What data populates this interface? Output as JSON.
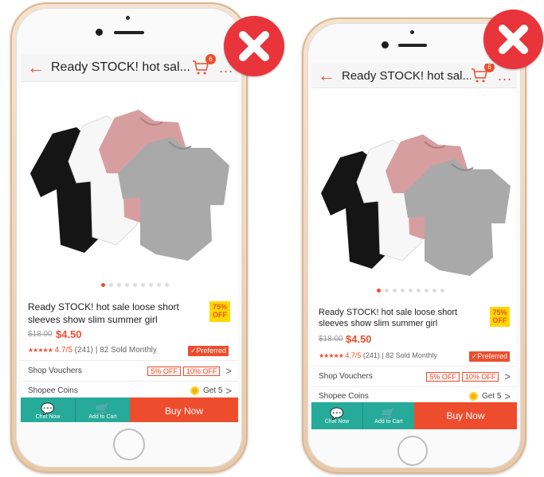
{
  "product": {
    "title_bar": "Ready STOCK!  hot sal...",
    "cart_count": "6",
    "more_icon": "...",
    "name": "Ready STOCK!  hot sale loose short sleeves show slim summer girl",
    "discount_pct": "75%",
    "discount_off": "OFF",
    "original_price": "$18.00",
    "price": "$4.50",
    "stars": "★★★★★",
    "rating": "4.7/5",
    "reviews": "(241)",
    "sold": "| 82 Sold Monthly",
    "preferred": "✓Preferred",
    "image_active_index": 0,
    "image_count": 9
  },
  "shop_vouchers": {
    "label": "Shop Vouchers",
    "v1": "5% OFF",
    "v2": "10% OFF"
  },
  "shopee_coins": {
    "label": "Shopee Coins",
    "value": "Get 5"
  },
  "actions": {
    "chat": "Chat Now",
    "add_to_cart": "Add to Cart",
    "buy_now": "Buy Now"
  },
  "colors": {
    "accent": "#ee4d2d",
    "teal": "#26aa99",
    "reject_badge": "#e8343a",
    "discount_badge": "#ffd800"
  },
  "icons": [
    "back-arrow-icon",
    "cart-icon",
    "more-icon",
    "chat-icon",
    "add-to-cart-icon",
    "coin-icon",
    "chevron-right-icon",
    "close-x-icon"
  ]
}
